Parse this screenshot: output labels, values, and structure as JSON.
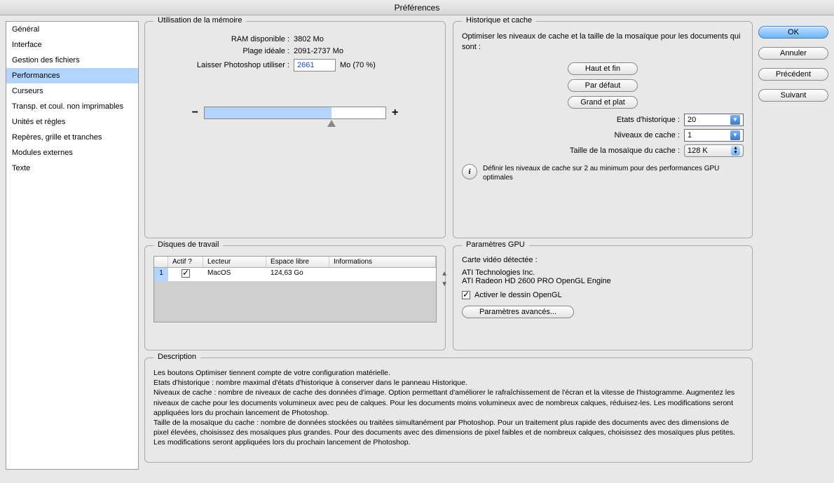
{
  "window": {
    "title": "Préférences"
  },
  "sidebar": {
    "items": [
      "Général",
      "Interface",
      "Gestion des fichiers",
      "Performances",
      "Curseurs",
      "Transp. et coul. non imprimables",
      "Unités et règles",
      "Repères, grille et tranches",
      "Modules externes",
      "Texte"
    ],
    "selected_index": 3
  },
  "buttons": {
    "ok": "OK",
    "cancel": "Annuler",
    "prev": "Précédent",
    "next": "Suivant"
  },
  "memory": {
    "title": "Utilisation de la mémoire",
    "ram_available_label": "RAM disponible :",
    "ram_available_value": "3802 Mo",
    "ideal_range_label": "Plage idéale :",
    "ideal_range_value": "2091-2737 Mo",
    "let_use_label": "Laisser Photoshop utiliser :",
    "let_use_value": "2661",
    "let_use_suffix": "Mo (70 %)",
    "minus": "−",
    "plus": "+",
    "slider_percent": 70
  },
  "history": {
    "title": "Historique et cache",
    "intro": "Optimiser les niveaux de cache et la taille de la mosaïque pour les documents qui sont :",
    "btn_tall": "Haut et fin",
    "btn_default": "Par défaut",
    "btn_big": "Grand et plat",
    "states_label": "Etats d'historique :",
    "states_value": "20",
    "levels_label": "Niveaux de cache :",
    "levels_value": "1",
    "tile_label": "Taille de la mosaïque du cache :",
    "tile_value": "128 K",
    "info": "Définir les niveaux de cache sur 2 au minimum pour des performances GPU optimales"
  },
  "scratch": {
    "title": "Disques de travail",
    "headers": {
      "active": "Actif ?",
      "drive": "Lecteur",
      "free": "Espace libre",
      "info": "Informations"
    },
    "rows": [
      {
        "n": "1",
        "active": true,
        "drive": "MacOS",
        "free": "124,63 Go",
        "info": ""
      }
    ]
  },
  "gpu": {
    "title": "Paramètres GPU",
    "detected_label": "Carte vidéo détectée :",
    "vendor": "ATI Technologies Inc.",
    "card": "ATI Radeon HD 2600 PRO OpenGL Engine",
    "enable_label": "Activer le dessin OpenGL",
    "enable_checked": true,
    "advanced_btn": "Paramètres avancés..."
  },
  "description": {
    "title": "Description",
    "text": "Les boutons Optimiser tiennent compte de votre configuration matérielle.\nEtats d'historique : nombre maximal d'états d'historique à conserver dans le panneau Historique.\nNiveaux de cache : nombre de niveaux de cache des données d'image. Option permettant d'améliorer le rafraîchissement de l'écran et la vitesse de l'histogramme. Augmentez les niveaux de cache pour les documents volumineux avec peu de calques. Pour les documents moins volumineux avec de nombreux calques, réduisez-les. Les modifications seront appliquées lors du prochain lancement de Photoshop.\nTaille de la mosaïque du cache : nombre de données stockées ou traitées simultanément par Photoshop. Pour un traitement plus rapide des documents avec des dimensions de pixel élevées, choisissez des mosaïques plus grandes. Pour des documents avec des dimensions de pixel faibles et de nombreux calques, choisissez des mosaïques plus petites. Les modifications seront appliquées lors du prochain lancement de Photoshop."
  }
}
